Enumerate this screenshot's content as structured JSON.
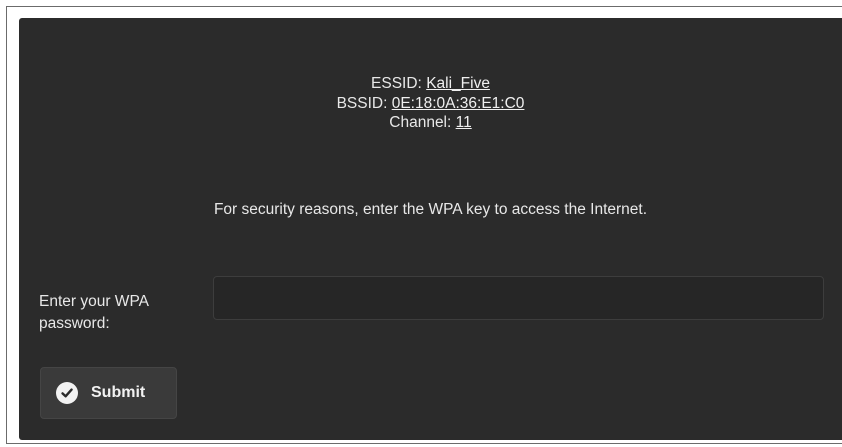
{
  "network": {
    "essid_label": "ESSID: ",
    "essid": "Kali_Five",
    "bssid_label": "BSSID: ",
    "bssid": "0E:18:0A:36:E1:C0",
    "channel_label": "Channel: ",
    "channel": "11"
  },
  "notice": "For security reasons, enter the WPA key to access the Internet.",
  "form": {
    "password_label_line1": "Enter your WPA",
    "password_label_line2": "password:",
    "password_value": "",
    "submit_label": "Submit",
    "submit_icon": "check-circle-icon"
  },
  "colors": {
    "panel_bg": "#2b2b2b",
    "text": "#e8e8e8",
    "button_bg": "#3a3a3a"
  }
}
